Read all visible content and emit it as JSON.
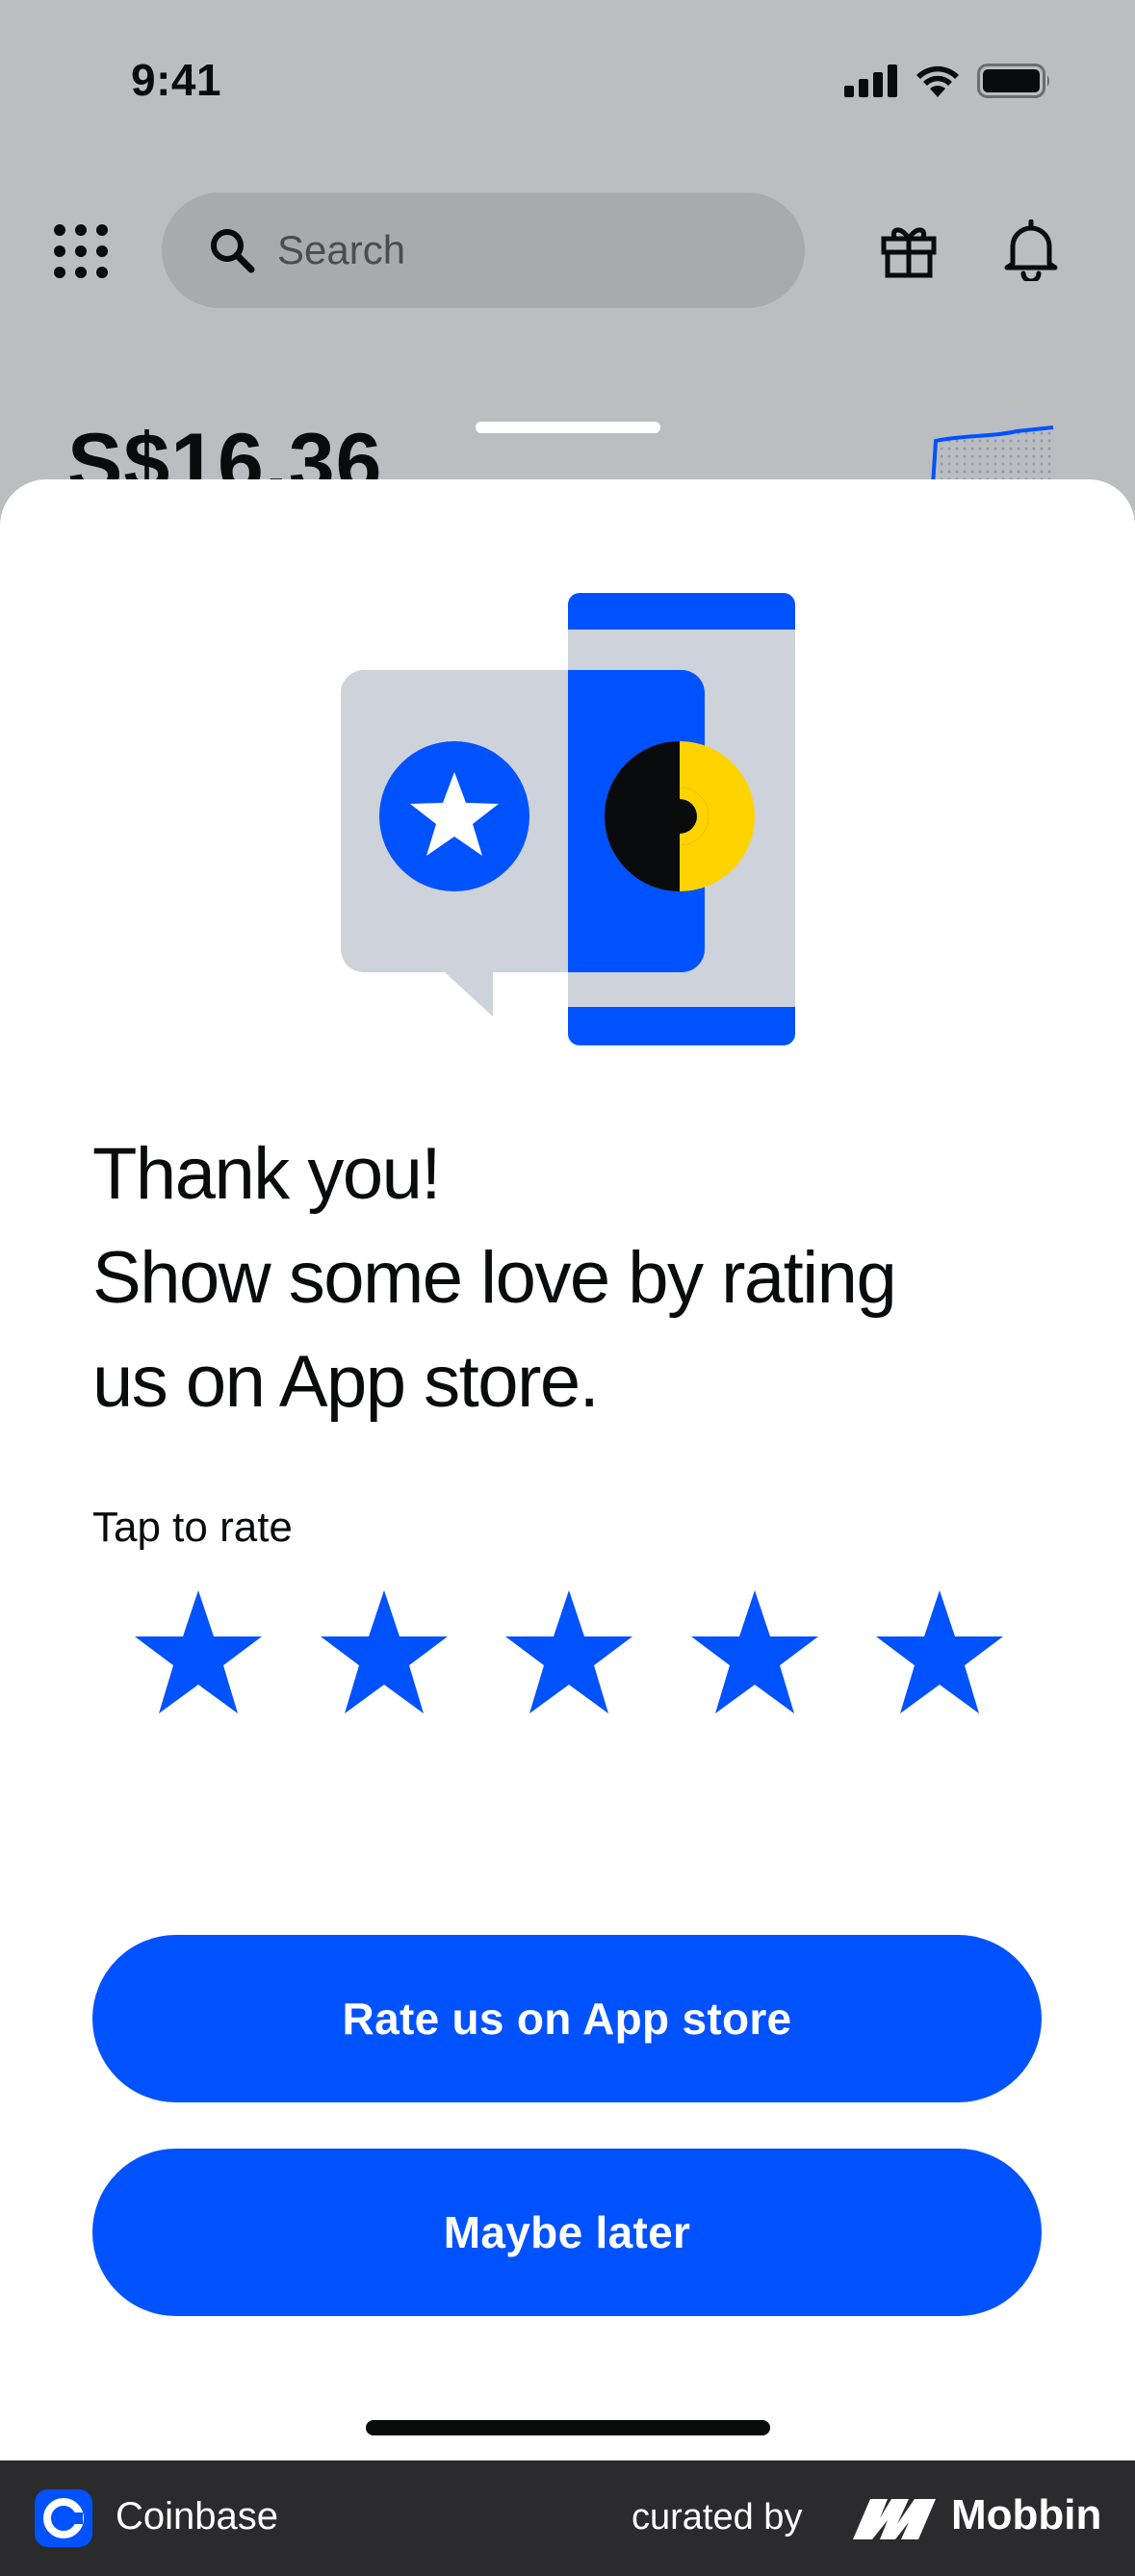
{
  "status_bar": {
    "time": "9:41"
  },
  "top_bar": {
    "search_placeholder": "Search"
  },
  "portfolio": {
    "balance": "S$16.36"
  },
  "sheet": {
    "headline_lines": [
      "Thank you!",
      "Show some love by rating",
      "us on App store."
    ],
    "tap_label": "Tap to rate",
    "rating": {
      "stars_total": 5,
      "stars_filled": 5
    },
    "primary_button": "Rate us on App store",
    "secondary_button": "Maybe later"
  },
  "footer": {
    "app_name": "Coinbase",
    "curated_by": "curated by",
    "brand": "Mobbin"
  },
  "colors": {
    "accent": "#0052ff",
    "illustration_gray": "#ced2db",
    "coin_yellow": "#ffd300",
    "text": "#0a0b0d",
    "overlay_background": "#bcbdc0",
    "footer_background": "#2b2b2e"
  }
}
